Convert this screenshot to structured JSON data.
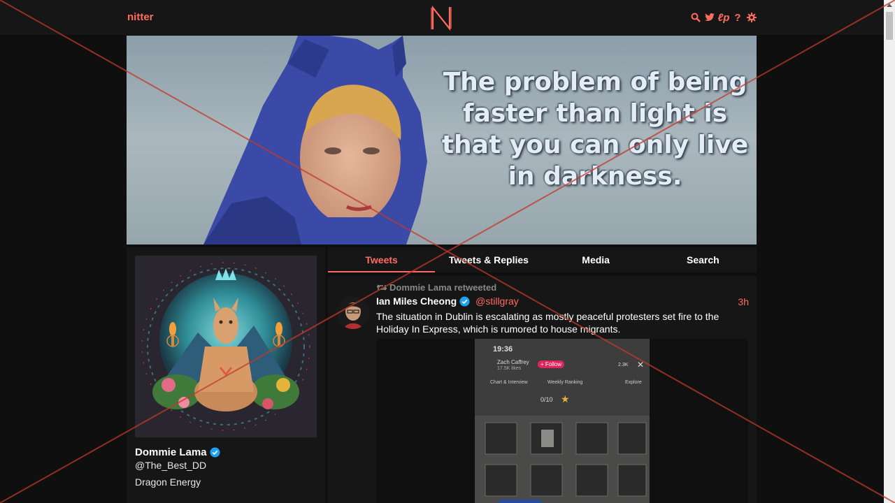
{
  "nav": {
    "brand": "nitter",
    "logo_letter": "N",
    "icons": [
      "search-icon",
      "twitter-bird-icon",
      "lp-icon",
      "help-icon",
      "gear-icon"
    ],
    "lp_label": "ℓp",
    "help_label": "?"
  },
  "banner": {
    "caption": "The problem of being faster than light is that you can only live in darkness."
  },
  "profile": {
    "name": "Dommie Lama",
    "handle": "@The_Best_DD",
    "bio": "Dragon Energy"
  },
  "tabs": [
    {
      "label": "Tweets",
      "active": true
    },
    {
      "label": "Tweets & Replies",
      "active": false
    },
    {
      "label": "Media",
      "active": false
    },
    {
      "label": "Search",
      "active": false
    }
  ],
  "tweet": {
    "retweet_label": "Dommie Lama retweeted",
    "fullname": "Ian Miles Cheong",
    "username": "@stillgray",
    "date": "3h",
    "text": "The situation in Dublin is escalating as mostly peaceful protesters set fire to the Holiday In Express, which is rumored to house migrants.",
    "media": {
      "time": "19:36",
      "user": "Zach Caffrey",
      "likes": "17.5K likes",
      "follow": "+ Follow",
      "count": "2.3K",
      "tab1": "Chart & Interview",
      "tab2": "Weekly Ranking",
      "tab3": "Explore",
      "score": "0/10"
    }
  },
  "colors": {
    "accent": "#ff6c60",
    "background": "#0f0f0f",
    "panel": "#161616",
    "overlay_x": "#c0392b"
  }
}
